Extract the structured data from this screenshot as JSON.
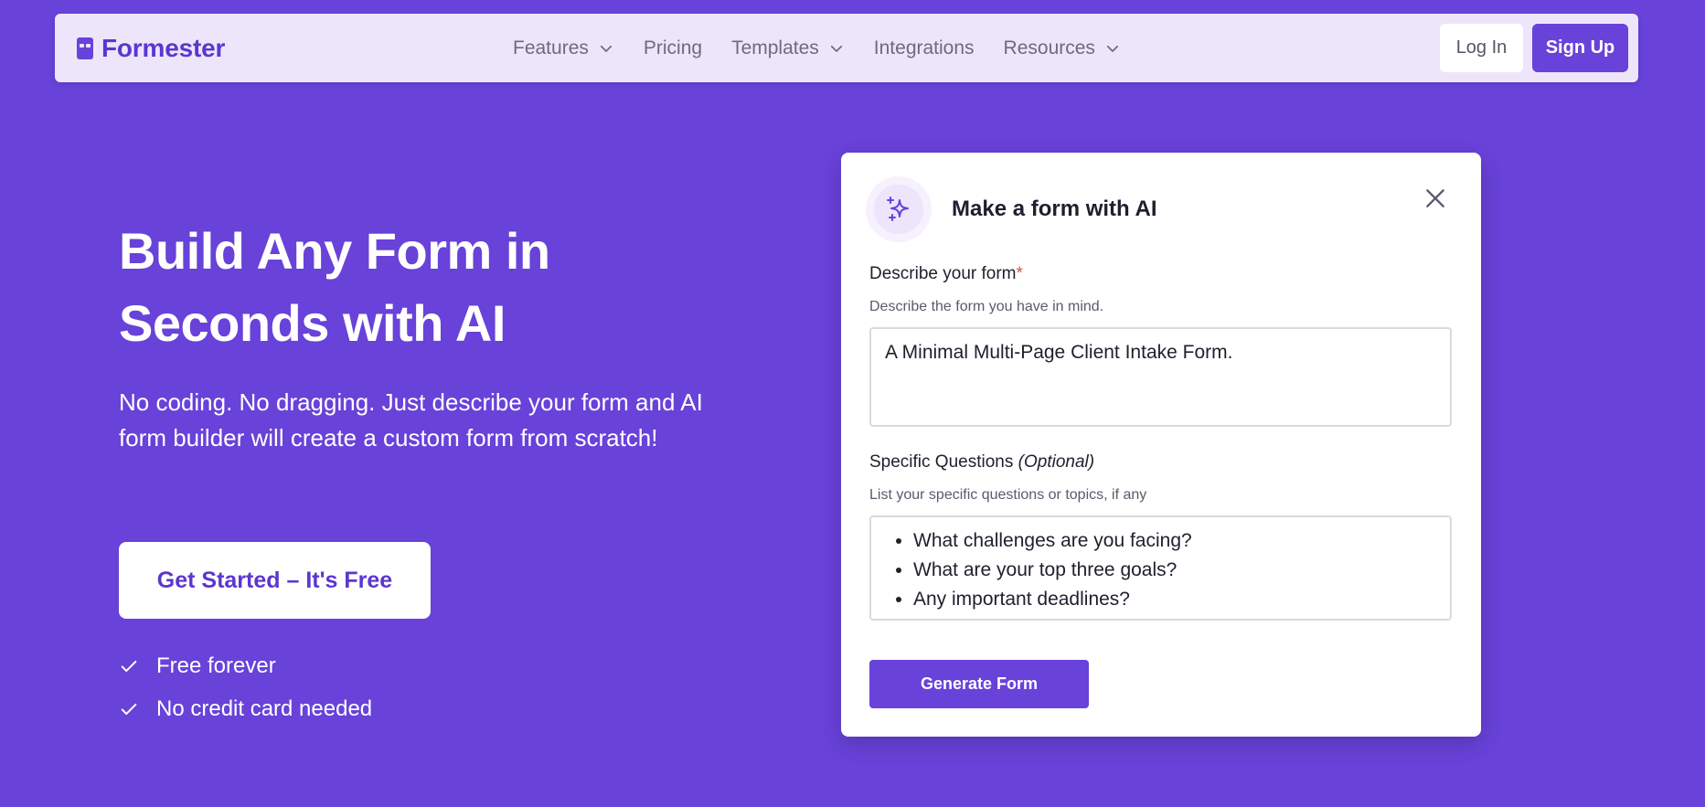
{
  "colors": {
    "background": "#6842d9",
    "navbar_bg": "#ede6fb",
    "brand": "#5b36cf",
    "primary_button": "#6842d9",
    "required_marker": "#e34b4b"
  },
  "navbar": {
    "logo_text": "Formester",
    "logo_icon": "formester-logo-icon",
    "links": [
      {
        "label": "Features",
        "has_dropdown": true
      },
      {
        "label": "Pricing",
        "has_dropdown": false
      },
      {
        "label": "Templates",
        "has_dropdown": true
      },
      {
        "label": "Integrations",
        "has_dropdown": false
      },
      {
        "label": "Resources",
        "has_dropdown": true
      }
    ],
    "login_label": "Log In",
    "signup_label": "Sign Up"
  },
  "hero": {
    "title": "Build Any Form in Seconds with AI",
    "subtitle": "No coding. No dragging. Just describe your form and AI form builder will create a custom form from scratch!",
    "cta_label": "Get Started – It's Free",
    "checks": [
      "Free forever",
      "No credit card needed"
    ]
  },
  "modal": {
    "icon": "sparkles-icon",
    "title": "Make a form with AI",
    "field1": {
      "label": "Describe your form",
      "required_marker": "*",
      "help": "Describe the form you have in mind.",
      "value": "A Minimal Multi-Page Client Intake Form."
    },
    "field2": {
      "label": "Specific Questions",
      "optional": "(Optional)",
      "help": "List your specific questions or topics, if any",
      "items": [
        "What challenges are you facing?",
        "What are your top three goals?",
        "Any important deadlines?"
      ]
    },
    "button_label": "Generate Form"
  }
}
